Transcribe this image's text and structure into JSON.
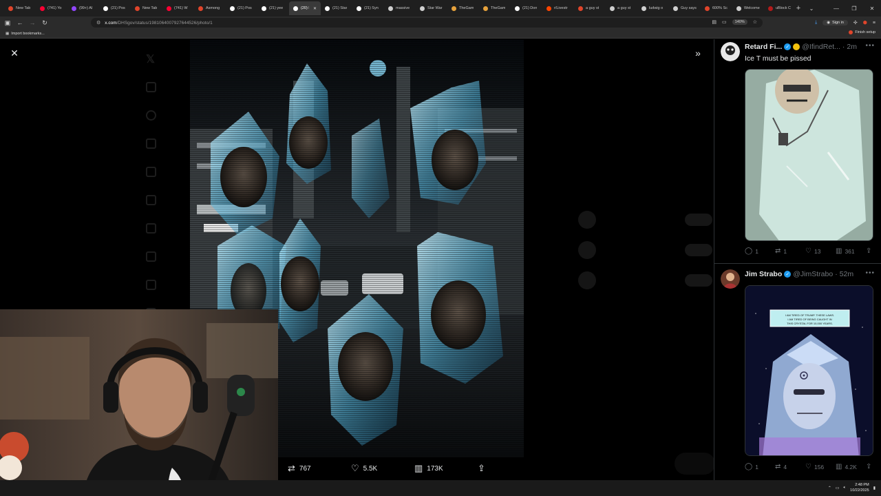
{
  "browser": {
    "tabs": [
      {
        "label": "New Tab",
        "color": "#e0452b"
      },
      {
        "label": "(741) Yo",
        "color": "#ff0033"
      },
      {
        "label": "(99+) Al",
        "color": "#9146ff"
      },
      {
        "label": "(21) Pos",
        "color": "#ffffff"
      },
      {
        "label": "New Tab",
        "color": "#e0452b"
      },
      {
        "label": "(741) W",
        "color": "#ff0033"
      },
      {
        "label": "Asmong",
        "color": "#e0452b"
      },
      {
        "label": "(21) Pos",
        "color": "#ffffff"
      },
      {
        "label": "(21) yee",
        "color": "#ffffff"
      },
      {
        "label": "(20) I",
        "color": "#ffffff",
        "active": true
      },
      {
        "label": "(21) Star",
        "color": "#ffffff"
      },
      {
        "label": "(21) Syn",
        "color": "#ffffff"
      },
      {
        "label": "massive",
        "color": "#cfcfcf"
      },
      {
        "label": "Star War",
        "color": "#cfcfcf"
      },
      {
        "label": "TheGam",
        "color": "#e6a23c"
      },
      {
        "label": "TheGam",
        "color": "#e6a23c"
      },
      {
        "label": "(21) Don",
        "color": "#ffffff"
      },
      {
        "label": "r/Livestr",
        "color": "#ff4500"
      },
      {
        "label": "a guy st",
        "color": "#e0452b"
      },
      {
        "label": "a guy st",
        "color": "#cfcfcf"
      },
      {
        "label": "ludwig o",
        "color": "#cfcfcf"
      },
      {
        "label": "Guy says",
        "color": "#cfcfcf"
      },
      {
        "label": "600% Sc",
        "color": "#e0452b"
      },
      {
        "label": "Welcome Pa",
        "color": "#cfcfcf"
      },
      {
        "label": "uBlock C",
        "color": "#b31b1b"
      }
    ],
    "new_tab_symbol": "+",
    "tab_menu_symbol": "⌄",
    "url_host": "x.com",
    "url_path": "/DHSgov/status/1981064007927644526/photo/1",
    "zoom": "140%",
    "signin_label": "Sign in",
    "bookmarks_label": "Import bookmarks...",
    "finish_setup_label": "Finish setup"
  },
  "modal": {
    "close_symbol": "✕",
    "expand_symbol": "»",
    "actions": {
      "retweets": "767",
      "likes": "5.5K",
      "views": "173K"
    }
  },
  "feed": {
    "posts": [
      {
        "name": "Retard Fi...",
        "handle": "@IfindRet...",
        "time": "2m",
        "text": "Ice T must be pissed",
        "replies": "1",
        "reposts": "1",
        "likes": "13",
        "views": "361"
      },
      {
        "name": "Jim Strabo",
        "handle": "@JimStrabo",
        "time": "52m",
        "replies": "1",
        "reposts": "4",
        "likes": "156",
        "views": "4.2K",
        "comic_caption": "I AM TIRED OF TRUMP. THESE LAWS. I AM TIRED OF BEING CAUGHT IN THIS CRYSTAL FOR 10,000 YEARS."
      }
    ]
  },
  "taskbar": {
    "time": "2:48 PM",
    "date": "10/22/2025"
  },
  "colors": {
    "accent": "#1d9bf0",
    "text_secondary": "#71767b",
    "crystal": "#7fd8ff"
  }
}
